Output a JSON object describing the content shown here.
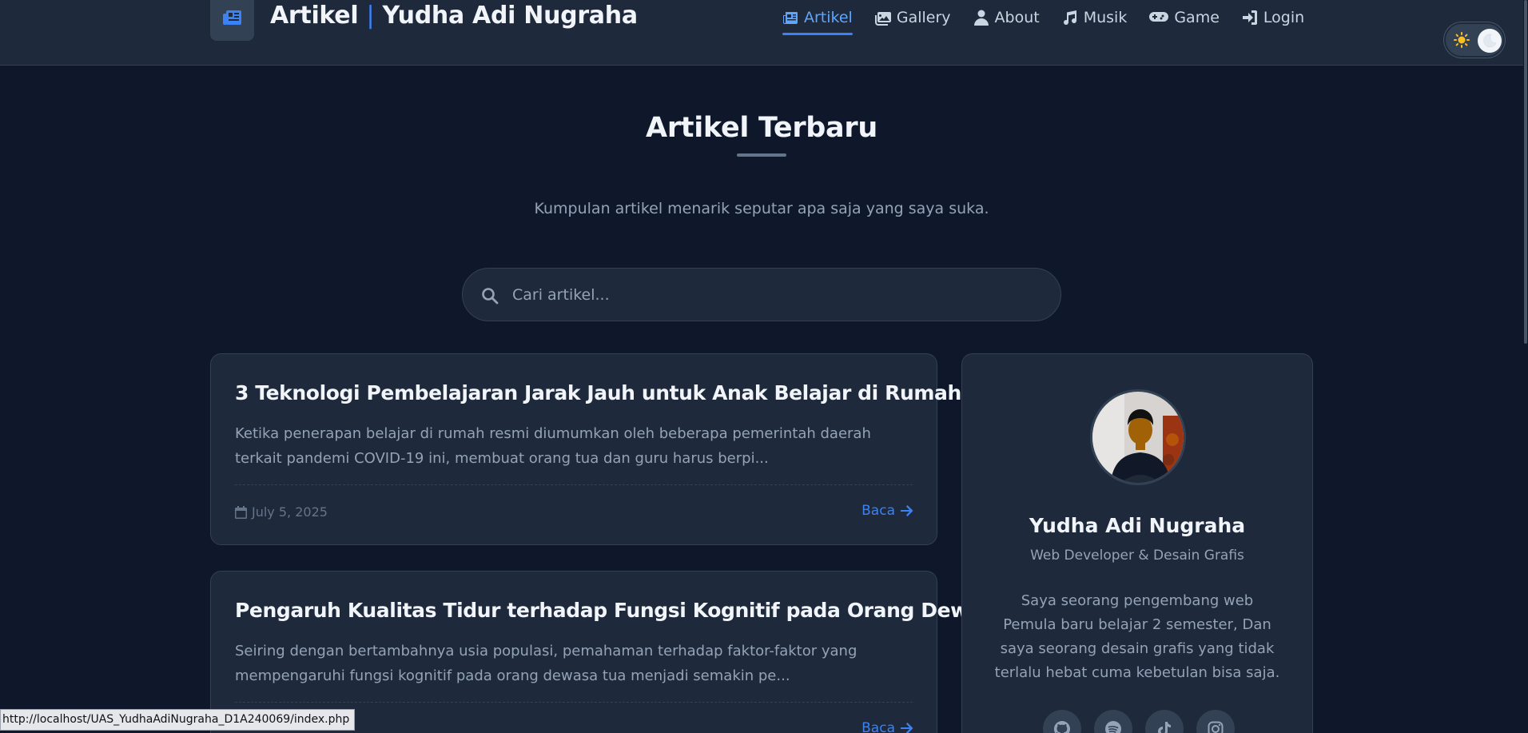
{
  "brand": {
    "title_part1": "Artikel",
    "separator": "|",
    "title_part2": "Yudha Adi Nugraha",
    "icon": "newspaper-icon"
  },
  "nav": {
    "items": [
      {
        "label": "Artikel",
        "icon": "newspaper-icon",
        "active": true
      },
      {
        "label": "Gallery",
        "icon": "images-icon"
      },
      {
        "label": "About",
        "icon": "user-icon"
      },
      {
        "label": "Musik",
        "icon": "music-icon"
      },
      {
        "label": "Game",
        "icon": "gamepad-icon"
      },
      {
        "label": "Login",
        "icon": "login-icon"
      }
    ]
  },
  "theme_toggle": {
    "sun_icon": "sun-icon",
    "moon_icon": "moon-icon"
  },
  "hero": {
    "title": "Artikel Terbaru",
    "subtitle": "Kumpulan artikel menarik seputar apa saja yang saya suka."
  },
  "search": {
    "placeholder": "Cari artikel...",
    "value": ""
  },
  "articles": [
    {
      "title": "3 Teknologi Pembelajaran Jarak Jauh untuk Anak Belajar di Rumah",
      "excerpt": "Ketika penerapan belajar di rumah resmi diumumkan oleh beberapa pemerintah daerah terkait pandemi COVID-19 ini, membuat orang tua dan guru harus berpi...",
      "date": "July 5, 2025",
      "read_label": "Baca"
    },
    {
      "title": "Pengaruh Kualitas Tidur terhadap Fungsi Kognitif pada Orang Dewasa Tua",
      "excerpt": "Seiring dengan bertambahnya usia populasi, pemahaman terhadap faktor-faktor yang mempengaruhi fungsi kognitif pada orang dewasa tua menjadi semakin pe...",
      "date": "",
      "read_label": "Baca"
    }
  ],
  "profile": {
    "name": "Yudha Adi Nugraha",
    "role": "Web Developer & Desain Grafis",
    "bio": "Saya seorang pengembang web Pemula baru belajar 2 semester, Dan saya seorang desain grafis yang tidak terlalu hebat cuma kebetulan bisa saja.",
    "socials": [
      "github-icon",
      "spotify-icon",
      "tiktok-icon",
      "instagram-icon"
    ]
  },
  "status_bar": {
    "url": "http://localhost/UAS_YudhaAdiNugraha_D1A240069/index.php"
  },
  "colors": {
    "background": "#0f172a",
    "surface": "#1e293b",
    "border": "#334155",
    "accent": "#3b82f6",
    "text": "#f1f5f9",
    "muted": "#94a3b8"
  }
}
